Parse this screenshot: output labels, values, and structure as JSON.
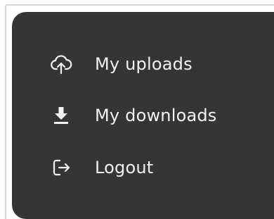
{
  "menu": {
    "items": [
      {
        "label": "My uploads",
        "icon": "cloud-upload-icon"
      },
      {
        "label": "My downloads",
        "icon": "download-icon"
      },
      {
        "label": "Logout",
        "icon": "logout-icon"
      }
    ]
  },
  "colors": {
    "menu_background": "#353535",
    "text": "#f2f2f2",
    "page_background": "#ffffff"
  }
}
